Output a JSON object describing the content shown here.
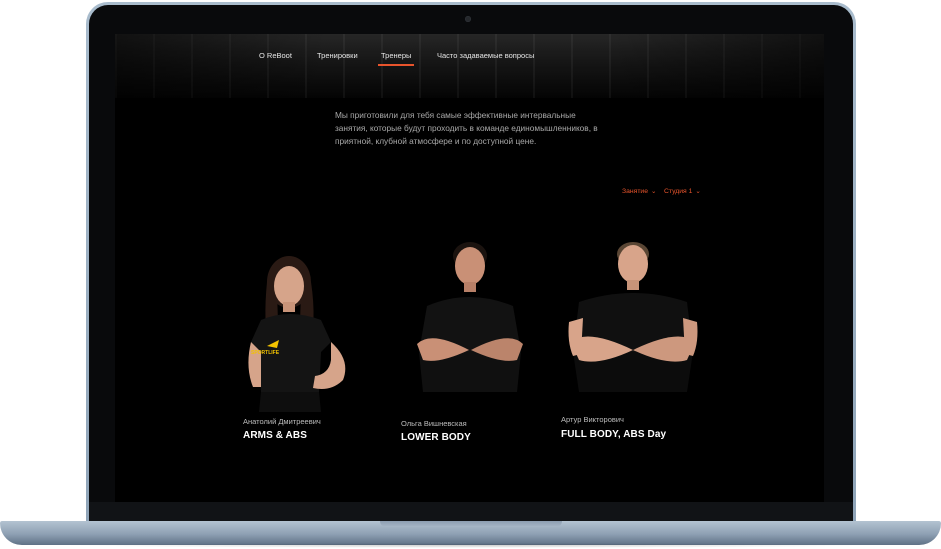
{
  "nav": {
    "items": [
      {
        "label": "О ReBoot",
        "active": false
      },
      {
        "label": "Тренировки",
        "active": false
      },
      {
        "label": "Тренеры",
        "active": true
      },
      {
        "label": "Часто задаваемые вопросы",
        "active": false
      }
    ]
  },
  "intro": {
    "line1": "Мы приготовили для тебя самые эффективные интервальные",
    "line2": "занятия, которые будут проходить в команде единомышленников, в",
    "line3": "приятной, клубной атмосфере и по доступной цене."
  },
  "filters": {
    "activity": "Занятие",
    "studio": "Студия 1"
  },
  "trainers": [
    {
      "name": "Анатолий Дмитреевич",
      "class": "ARMS & ABS",
      "shirt_text": "SPORTLIFE"
    },
    {
      "name": "Ольга Вишневская",
      "class": "LOWER BODY"
    },
    {
      "name": "Артур Викторович",
      "class": "FULL BODY, ABS Day"
    }
  ],
  "colors": {
    "accent": "#e8542c",
    "background": "#000000",
    "laptop_frame": "#9fb2c4"
  }
}
